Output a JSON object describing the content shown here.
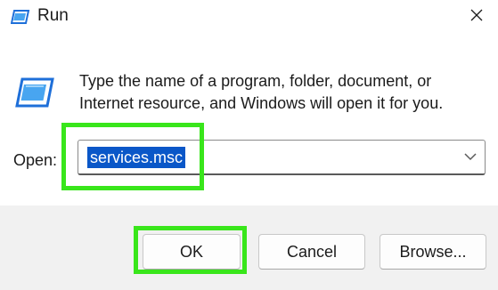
{
  "window": {
    "title": "Run",
    "close_glyph": "✕"
  },
  "icons": {
    "title_icon": "run-app-icon",
    "dialog_icon": "run-app-icon",
    "close_icon": "close-icon",
    "dropdown_icon": "chevron-down-icon"
  },
  "content": {
    "description": "Type the name of a program, folder, document, or Internet resource, and Windows will open it for you.",
    "open_label": "Open:",
    "open_value": "services.msc"
  },
  "buttons": {
    "ok": "OK",
    "cancel": "Cancel",
    "browse": "Browse..."
  },
  "colors": {
    "highlight": "#39e61b",
    "selection": "#0a57c8",
    "accent_icon": "#1e88e5"
  }
}
